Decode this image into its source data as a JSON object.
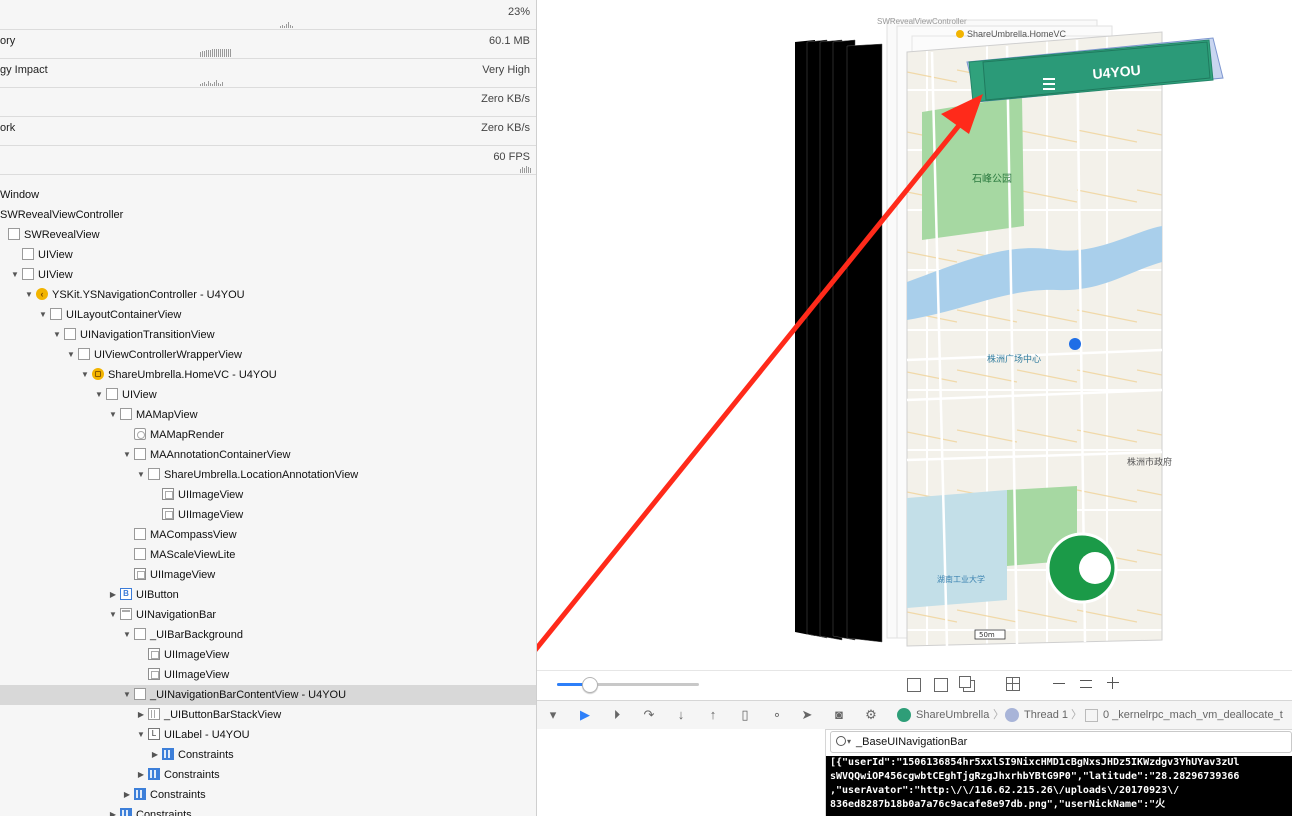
{
  "gauges": [
    {
      "label": "",
      "value": "23%"
    },
    {
      "label": "ory",
      "value": "60.1 MB"
    },
    {
      "label": "gy Impact",
      "value": "Very High"
    },
    {
      "label": "",
      "value": "Zero KB/s"
    },
    {
      "label": "ork",
      "value": "Zero KB/s"
    },
    {
      "label": "",
      "value": "60 FPS"
    }
  ],
  "tree": [
    {
      "label": "Window",
      "depth": 0,
      "icon": "none",
      "arrow": "",
      "selected": false
    },
    {
      "label": "SWRevealViewController",
      "depth": 0,
      "icon": "none",
      "arrow": "",
      "selected": false
    },
    {
      "label": "SWRevealView",
      "depth": 0,
      "icon": "view",
      "arrow": "",
      "selected": false
    },
    {
      "label": "UIView",
      "depth": 1,
      "icon": "view",
      "arrow": "",
      "selected": false
    },
    {
      "label": "UIView",
      "depth": 1,
      "icon": "view",
      "arrow": "down",
      "selected": false
    },
    {
      "label": "YSKit.YSNavigationController - U4YOU",
      "depth": 2,
      "icon": "nav",
      "arrow": "down",
      "selected": false
    },
    {
      "label": "UILayoutContainerView",
      "depth": 3,
      "icon": "view",
      "arrow": "down",
      "selected": false
    },
    {
      "label": "UINavigationTransitionView",
      "depth": 4,
      "icon": "view",
      "arrow": "down",
      "selected": false
    },
    {
      "label": "UIViewControllerWrapperView",
      "depth": 5,
      "icon": "view",
      "arrow": "down",
      "selected": false
    },
    {
      "label": "ShareUmbrella.HomeVC - U4YOU",
      "depth": 6,
      "icon": "vc",
      "arrow": "down",
      "selected": false
    },
    {
      "label": "UIView",
      "depth": 7,
      "icon": "view",
      "arrow": "down",
      "selected": false
    },
    {
      "label": "MAMapView",
      "depth": 8,
      "icon": "view",
      "arrow": "down",
      "selected": false
    },
    {
      "label": "MAMapRender",
      "depth": 9,
      "icon": "ctl",
      "arrow": "",
      "selected": false
    },
    {
      "label": "MAAnnotationContainerView",
      "depth": 9,
      "icon": "view",
      "arrow": "down",
      "selected": false
    },
    {
      "label": "ShareUmbrella.LocationAnnotationView",
      "depth": 10,
      "icon": "view",
      "arrow": "down",
      "selected": false
    },
    {
      "label": "UIImageView",
      "depth": 11,
      "icon": "img",
      "arrow": "",
      "selected": false
    },
    {
      "label": "UIImageView",
      "depth": 11,
      "icon": "img",
      "arrow": "",
      "selected": false
    },
    {
      "label": "MACompassView",
      "depth": 9,
      "icon": "view",
      "arrow": "",
      "selected": false
    },
    {
      "label": "MAScaleViewLite",
      "depth": 9,
      "icon": "view",
      "arrow": "",
      "selected": false
    },
    {
      "label": "UIImageView",
      "depth": 9,
      "icon": "img",
      "arrow": "",
      "selected": false
    },
    {
      "label": "UIButton",
      "depth": 8,
      "icon": "btn",
      "arrow": "right",
      "selected": false
    },
    {
      "label": "UINavigationBar",
      "depth": 8,
      "icon": "bar",
      "arrow": "down",
      "selected": false
    },
    {
      "label": "_UIBarBackground",
      "depth": 9,
      "icon": "view",
      "arrow": "down",
      "selected": false
    },
    {
      "label": "UIImageView",
      "depth": 10,
      "icon": "img",
      "arrow": "",
      "selected": false
    },
    {
      "label": "UIImageView",
      "depth": 10,
      "icon": "img",
      "arrow": "",
      "selected": false
    },
    {
      "label": "_UINavigationBarContentView - U4YOU",
      "depth": 9,
      "icon": "view",
      "arrow": "down",
      "selected": true
    },
    {
      "label": "_UIButtonBarStackView",
      "depth": 10,
      "icon": "stack",
      "arrow": "right",
      "selected": false
    },
    {
      "label": "UILabel - U4YOU",
      "depth": 10,
      "icon": "lbl",
      "arrow": "down",
      "selected": false
    },
    {
      "label": "Constraints",
      "depth": 11,
      "icon": "cons",
      "arrow": "right",
      "selected": false
    },
    {
      "label": "Constraints",
      "depth": 10,
      "icon": "cons",
      "arrow": "right",
      "selected": false
    },
    {
      "label": "Constraints",
      "depth": 9,
      "icon": "cons",
      "arrow": "right",
      "selected": false
    },
    {
      "label": "Constraints",
      "depth": 8,
      "icon": "cons",
      "arrow": "right",
      "selected": false
    }
  ],
  "canvas": {
    "title_back": "SWRevealViewController",
    "title_front": "ShareUmbrella.HomeVC",
    "navbar_title": "U4YOU",
    "map_labels": [
      "石峰公园",
      "株洲广场中心",
      "株洲市政府",
      "湖南工业大学"
    ],
    "map_badge": "50m",
    "accent": "#2e9e78",
    "arrow_color": "#ff2a1a"
  },
  "debug": {
    "breadcrumb_app": "ShareUmbrella",
    "breadcrumb_thread": "Thread 1",
    "breadcrumb_frame": "0 _kernelrpc_mach_vm_deallocate_t"
  },
  "console": {
    "filter_text": "_BaseUINavigationBar",
    "lines": [
      "[{\"userId\":\"1506136854hr5xxlSI9NixcHMD1cBgNxsJHDz5IKWzdgv3YhUYav3zUl",
      "sWVQQwiOP456cgwbtCEghTjgRzgJhxrhbYBtG9P0\",\"latitude\":\"28.28296739366",
      ",\"userAvator\":\"http:\\/\\/116.62.215.26\\/uploads\\/20170923\\/",
      "836ed8287b18b0a7a76c9acafe8e97db.png\",\"userNickName\":\"火"
    ]
  }
}
